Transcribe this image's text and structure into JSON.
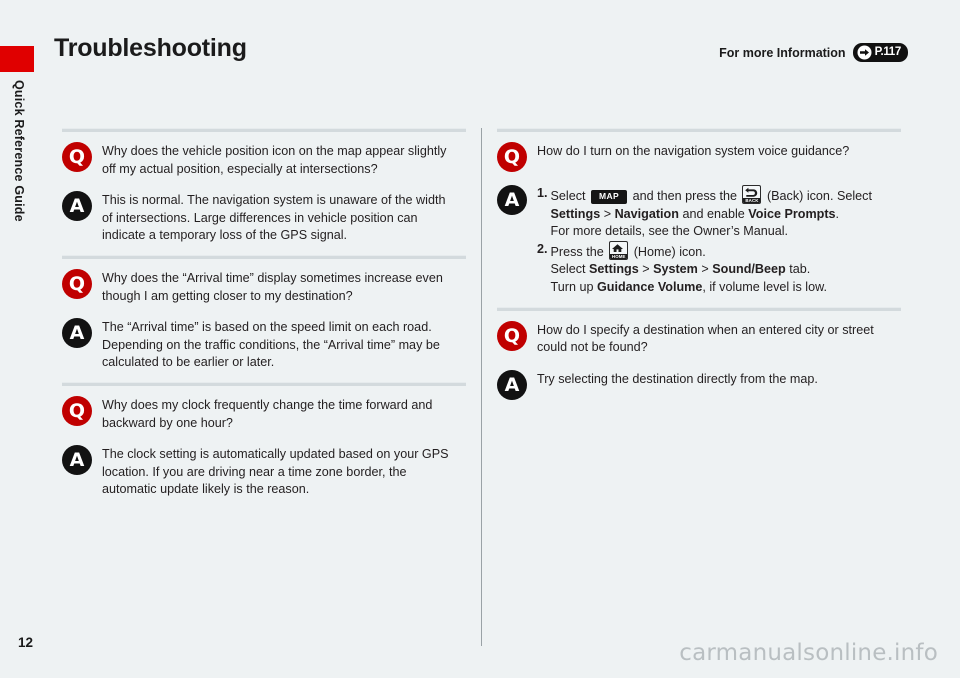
{
  "sidebar": {
    "tab_label": "Quick Reference Guide",
    "tab_color": "#e00000"
  },
  "header": {
    "title": "Troubleshooting",
    "more_info_label": "For more Information",
    "reference_page": "P.117",
    "reference_arrow_icon": "arrow-right-icon"
  },
  "columns": {
    "left": [
      {
        "question": "Why does the vehicle position icon on the map appear slightly off my actual position, especially at intersections?",
        "answer": "This is normal. The navigation system is unaware of the width of intersections. Large differences in vehicle position can indicate a temporary loss of the GPS signal."
      },
      {
        "question": "Why does the “Arrival time” display sometimes increase even though I am getting closer to my destination?",
        "answer": "The “Arrival time” is based on the speed limit on each road. Depending on the traffic conditions, the “Arrival time” may be calculated to be earlier or later."
      },
      {
        "question": "Why does my clock frequently change the time forward and backward by one hour?",
        "answer": "The clock setting is automatically updated based on your GPS location. If you are driving near a time zone border, the automatic update likely is the reason."
      }
    ],
    "right": [
      {
        "question": "How do I turn on the navigation system voice guidance?",
        "steps": [
          {
            "number": "1.",
            "line1_pre": "Select",
            "map_key_label": "MAP",
            "line1_mid": "and then press the",
            "back_key_label": "BACK",
            "line1_post": "(Back) icon. Select",
            "line2_pre": "Settings",
            "line2_sep1": " > ",
            "line2_b1": "Navigation",
            "line2_mid": " and enable ",
            "line2_b2": "Voice Prompts",
            "line2_end": ".",
            "line3": "For more details, see the Owner’s Manual."
          },
          {
            "number": "2.",
            "line1_pre": "Press the",
            "home_key_label": "HOME",
            "line1_post": "(Home) icon.",
            "line2_pre": "Select ",
            "line2_b1": "Settings",
            "line2_sep1": " > ",
            "line2_b2": "System",
            "line2_sep2": " > ",
            "line2_b3": "Sound/Beep",
            "line2_end": " tab.",
            "line3_pre": "Turn up ",
            "line3_b1": "Guidance Volume",
            "line3_end": ", if volume level is low."
          }
        ]
      },
      {
        "question": "How do I specify a destination when an entered city or street could not be found?",
        "answer": "Try selecting the destination directly from the map."
      }
    ]
  },
  "badges": {
    "question_letter": "Q",
    "answer_letter": "A",
    "question_color": "#c00000",
    "answer_color": "#121212"
  },
  "footer": {
    "page_number": "12",
    "watermark": "carmanualsonline.info"
  }
}
